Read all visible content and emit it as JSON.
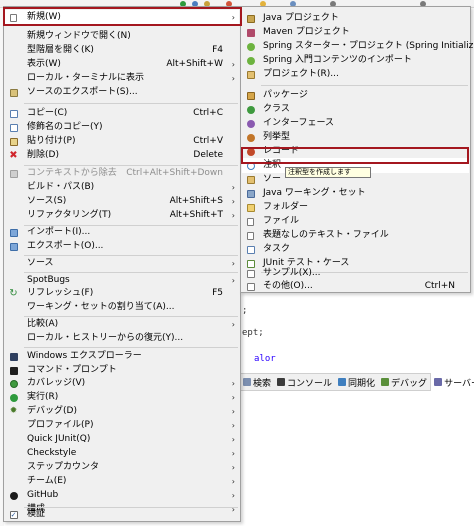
{
  "main_menu": {
    "items": [
      {
        "label": "新規(W)",
        "shortcut": "",
        "submenu": true,
        "icon": "new-icon",
        "disabled": false
      },
      {
        "label": "新規ウィンドウで開く(N)",
        "shortcut": "",
        "submenu": false,
        "icon": "",
        "disabled": false
      },
      {
        "label": "型階層を開く(K)",
        "shortcut": "F4",
        "submenu": false,
        "icon": "",
        "disabled": false
      },
      {
        "label": "表示(W)",
        "shortcut": "Alt+Shift+W",
        "submenu": true,
        "icon": "",
        "disabled": false
      },
      {
        "label": "ローカル・ターミナルに表示",
        "shortcut": "",
        "submenu": true,
        "icon": "",
        "disabled": false
      },
      {
        "label": "ソースのエクスポート(S)...",
        "shortcut": "",
        "submenu": false,
        "icon": "export-source-icon",
        "disabled": false
      },
      {
        "label": "コピー(C)",
        "shortcut": "Ctrl+C",
        "submenu": false,
        "icon": "copy-icon",
        "disabled": false
      },
      {
        "label": "修飾名のコピー(Y)",
        "shortcut": "",
        "submenu": false,
        "icon": "copy-qualified-icon",
        "disabled": false
      },
      {
        "label": "貼り付け(P)",
        "shortcut": "Ctrl+V",
        "submenu": false,
        "icon": "paste-icon",
        "disabled": false
      },
      {
        "label": "削除(D)",
        "shortcut": "Delete",
        "submenu": false,
        "icon": "delete-icon",
        "disabled": false
      },
      {
        "label": "コンテキストから除去",
        "shortcut": "Ctrl+Alt+Shift+Down",
        "submenu": false,
        "icon": "remove-context-icon",
        "disabled": true
      },
      {
        "label": "ビルド・パス(B)",
        "shortcut": "",
        "submenu": true,
        "icon": "",
        "disabled": false
      },
      {
        "label": "ソース(S)",
        "shortcut": "Alt+Shift+S",
        "submenu": true,
        "icon": "",
        "disabled": false
      },
      {
        "label": "リファクタリング(T)",
        "shortcut": "Alt+Shift+T",
        "submenu": true,
        "icon": "",
        "disabled": false
      },
      {
        "label": "インポート(I)...",
        "shortcut": "",
        "submenu": false,
        "icon": "import-icon",
        "disabled": false
      },
      {
        "label": "エクスポート(O)...",
        "shortcut": "",
        "submenu": false,
        "icon": "export-icon",
        "disabled": false
      },
      {
        "label": "ソース",
        "shortcut": "",
        "submenu": true,
        "icon": "",
        "disabled": false
      },
      {
        "label": "SpotBugs",
        "shortcut": "",
        "submenu": true,
        "icon": "",
        "disabled": false
      },
      {
        "label": "リフレッシュ(F)",
        "shortcut": "F5",
        "submenu": false,
        "icon": "refresh-icon",
        "disabled": false
      },
      {
        "label": "ワーキング・セットの割り当て(A)...",
        "shortcut": "",
        "submenu": false,
        "icon": "",
        "disabled": false
      },
      {
        "label": "比較(A)",
        "shortcut": "",
        "submenu": true,
        "icon": "",
        "disabled": false
      },
      {
        "label": "ローカル・ヒストリーからの復元(Y)...",
        "shortcut": "",
        "submenu": false,
        "icon": "",
        "disabled": false
      },
      {
        "label": "Windows エクスプローラー",
        "shortcut": "",
        "submenu": false,
        "icon": "explorer-icon",
        "disabled": false
      },
      {
        "label": "コマンド・プロンプト",
        "shortcut": "",
        "submenu": false,
        "icon": "terminal-icon",
        "disabled": false
      },
      {
        "label": "カバレッジ(V)",
        "shortcut": "",
        "submenu": true,
        "icon": "coverage-icon",
        "disabled": false
      },
      {
        "label": "実行(R)",
        "shortcut": "",
        "submenu": true,
        "icon": "run-icon",
        "disabled": false
      },
      {
        "label": "デバッグ(D)",
        "shortcut": "",
        "submenu": true,
        "icon": "debug-icon",
        "disabled": false
      },
      {
        "label": "プロファイル(P)",
        "shortcut": "",
        "submenu": true,
        "icon": "",
        "disabled": false
      },
      {
        "label": "Quick JUnit(Q)",
        "shortcut": "",
        "submenu": true,
        "icon": "",
        "disabled": false
      },
      {
        "label": "Checkstyle",
        "shortcut": "",
        "submenu": true,
        "icon": "",
        "disabled": false
      },
      {
        "label": "ステップカウンタ",
        "shortcut": "",
        "submenu": true,
        "icon": "",
        "disabled": false
      },
      {
        "label": "チーム(E)",
        "shortcut": "",
        "submenu": true,
        "icon": "",
        "disabled": false
      },
      {
        "label": "GitHub",
        "shortcut": "",
        "submenu": true,
        "icon": "github-icon",
        "disabled": false
      },
      {
        "label": "構成",
        "shortcut": "",
        "submenu": true,
        "icon": "",
        "disabled": false
      },
      {
        "label": "検証",
        "shortcut": "",
        "submenu": false,
        "icon": "validate-checkbox-icon",
        "disabled": false
      }
    ]
  },
  "sub_menu": {
    "items": [
      {
        "label": "Java プロジェクト",
        "shortcut": "",
        "icon": "java-project-icon"
      },
      {
        "label": "Maven プロジェクト",
        "shortcut": "",
        "icon": "maven-project-icon"
      },
      {
        "label": "Spring スターター・プロジェクト (Spring Initializr)",
        "shortcut": "",
        "icon": "spring-starter-icon"
      },
      {
        "label": "Spring 入門コンテンツのインポート",
        "shortcut": "",
        "icon": "spring-import-icon"
      },
      {
        "label": "プロジェクト(R)...",
        "shortcut": "",
        "icon": "project-icon"
      },
      {
        "label": "パッケージ",
        "shortcut": "",
        "icon": "package-icon"
      },
      {
        "label": "クラス",
        "shortcut": "",
        "icon": "class-icon"
      },
      {
        "label": "インターフェース",
        "shortcut": "",
        "icon": "interface-icon"
      },
      {
        "label": "列挙型",
        "shortcut": "",
        "icon": "enum-icon"
      },
      {
        "label": "レコード",
        "shortcut": "",
        "icon": "record-icon"
      },
      {
        "label": "注釈",
        "shortcut": "",
        "icon": "annotation-icon"
      },
      {
        "label": "ソー",
        "shortcut": "",
        "icon": "source-folder-icon"
      },
      {
        "label": "Java ワーキング・セット",
        "shortcut": "",
        "icon": "working-set-icon"
      },
      {
        "label": "フォルダー",
        "shortcut": "",
        "icon": "folder-icon"
      },
      {
        "label": "ファイル",
        "shortcut": "",
        "icon": "file-icon"
      },
      {
        "label": "表題なしのテキスト・ファイル",
        "shortcut": "",
        "icon": "untitled-text-icon"
      },
      {
        "label": "タスク",
        "shortcut": "",
        "icon": "task-icon"
      },
      {
        "label": "JUnit テスト・ケース",
        "shortcut": "",
        "icon": "junit-icon"
      },
      {
        "label": "サンプル(X)...",
        "shortcut": "",
        "icon": "example-icon"
      },
      {
        "label": "その他(O)...",
        "shortcut": "Ctrl+N",
        "icon": "other-icon"
      }
    ]
  },
  "tooltip": {
    "text": "注釈型を作成します"
  },
  "ide": {
    "code_lines": [
      ";",
      "ept;",
      "alor"
    ],
    "tabs": [
      "検索",
      "コンソール",
      "同期化",
      "デバッグ",
      "サーバー"
    ],
    "tab_close": "✕"
  },
  "colors": {
    "menu_bg": "#f0f0f0",
    "highlight_border": "#a4171f",
    "tooltip_bg": "#ffffe1"
  }
}
